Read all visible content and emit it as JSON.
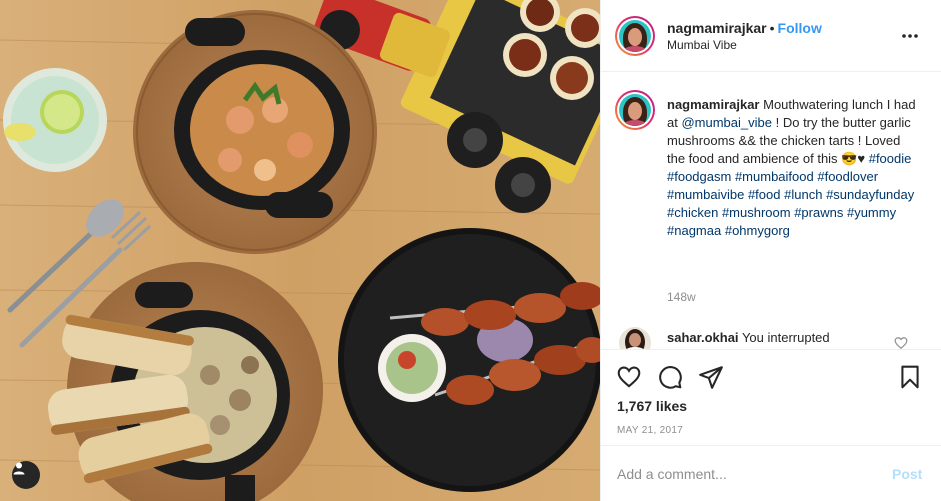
{
  "post": {
    "username": "nagmamirajkar",
    "separator": "•",
    "follow_label": "Follow",
    "location": "Mumbai Vibe",
    "more_icon": "more-options-icon",
    "caption": {
      "username": "nagmamirajkar",
      "text_before_mention": "Mouthwatering lunch I had at",
      "mention": "@mumbai_vibe",
      "text_after_mention": "! Do try the butter garlic mushrooms && the chicken tarts ! Loved the food and ambience of this",
      "emoji": "😎♥",
      "hashtags": [
        "#foodie",
        "#foodgasm",
        "#mumbaifood",
        "#foodlover",
        "#mumbaivibe",
        "#food",
        "#lunch",
        "#sundayfunday",
        "#chicken",
        "#mushroom",
        "#prawns",
        "#yummy",
        "#nagmaa",
        "#ohmygorg"
      ],
      "time_ago": "148w"
    },
    "comments": [
      {
        "username": "sahar.okhai",
        "text": "You interrupted"
      }
    ],
    "likes": "1,767 likes",
    "date": "MAY 21, 2017",
    "comment_placeholder": "Add a comment...",
    "post_label": "Post"
  },
  "colors": {
    "link_blue": "#3897f0",
    "hashtag": "#00376b",
    "muted": "#8e8e8e",
    "post_disabled": "#b2dffc"
  }
}
